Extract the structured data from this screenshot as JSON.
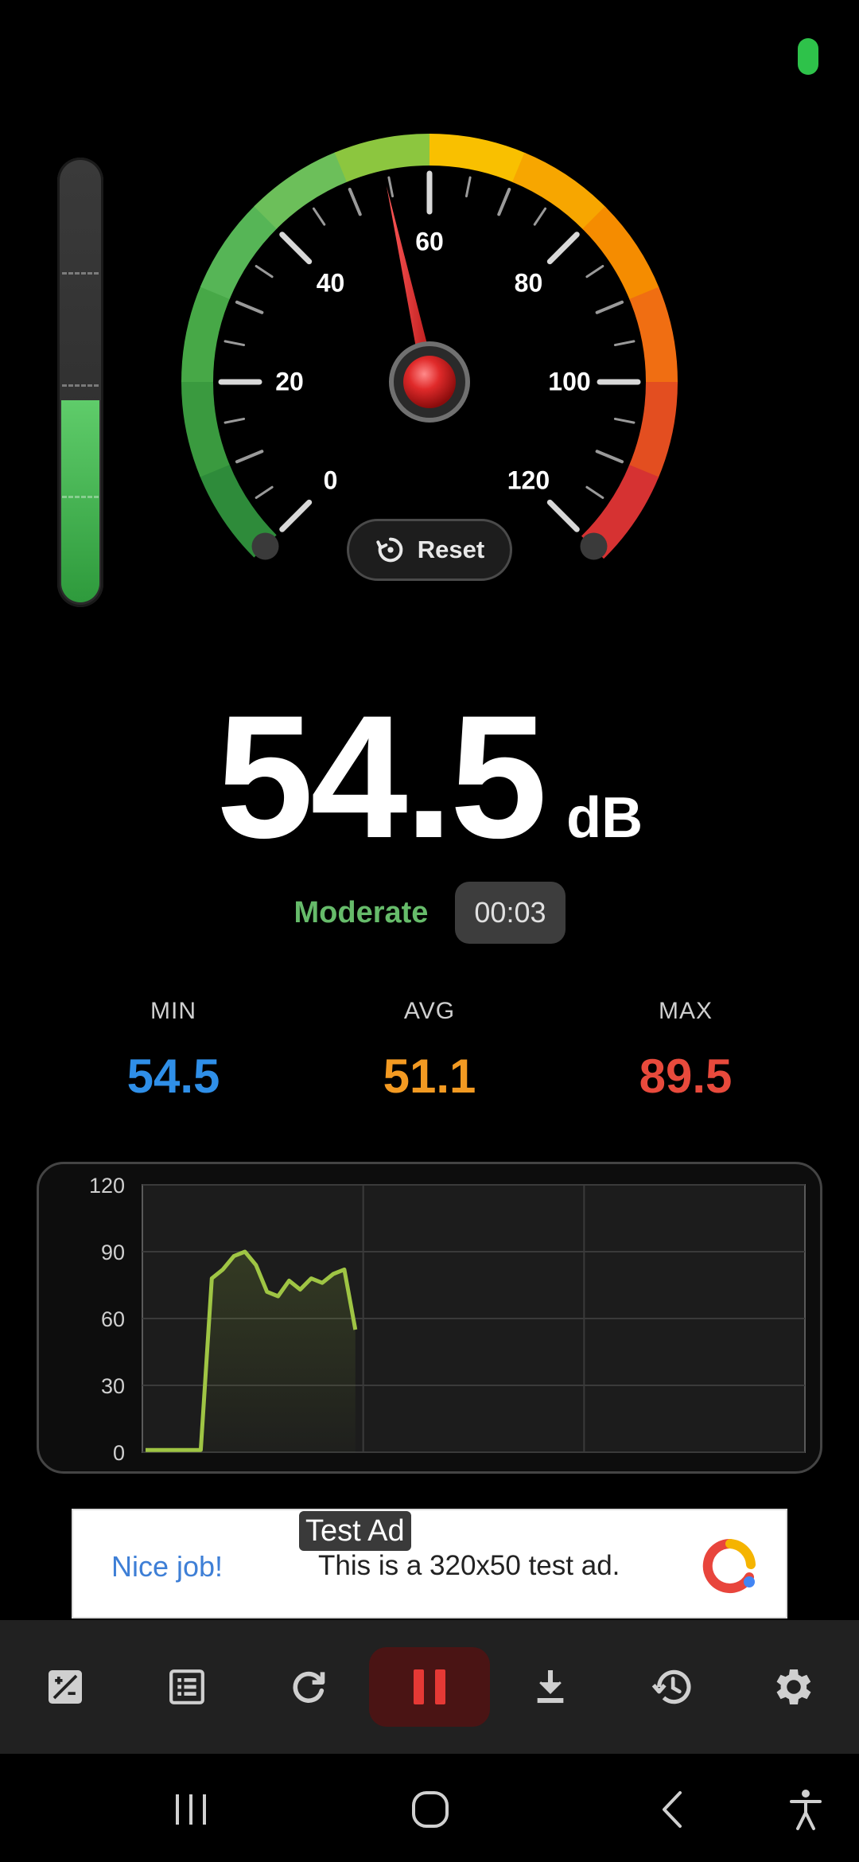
{
  "gauge": {
    "labels": [
      "0",
      "20",
      "40",
      "60",
      "80",
      "100",
      "120"
    ],
    "current_value": 54.5,
    "min": 0,
    "max": 120,
    "reset_label": "Reset"
  },
  "level_meter": {
    "fill_fraction": 0.46
  },
  "reading": {
    "value": "54.5",
    "unit": "dB"
  },
  "status": {
    "level": "Moderate",
    "timer": "00:03"
  },
  "stats": {
    "min": {
      "label": "MIN",
      "value": "54.5",
      "color": "#2f8fe8"
    },
    "avg": {
      "label": "AVG",
      "value": "51.1",
      "color": "#f39a22"
    },
    "max": {
      "label": "MAX",
      "value": "89.5",
      "color": "#e84a3c"
    }
  },
  "chart_data": {
    "type": "line",
    "y_ticks": [
      "120",
      "90",
      "60",
      "30",
      "0"
    ],
    "ylim": [
      0,
      120
    ],
    "x_points": 60,
    "values": [
      1,
      1,
      1,
      1,
      1,
      1,
      78,
      82,
      88,
      90,
      84,
      72,
      70,
      77,
      73,
      78,
      76,
      80,
      82,
      55
    ],
    "line_color": "#9fc544"
  },
  "ad": {
    "badge": "Test Ad",
    "headline": "Nice job!",
    "text": "This is a 320x50 test ad."
  },
  "toolbar": {
    "items": [
      "add-note-icon",
      "list-icon",
      "refresh-icon",
      "pause-icon",
      "download-icon",
      "history-icon",
      "settings-icon"
    ]
  },
  "navbar": {
    "items": [
      "recent-apps-icon",
      "home-icon",
      "back-icon",
      "accessibility-icon"
    ]
  }
}
